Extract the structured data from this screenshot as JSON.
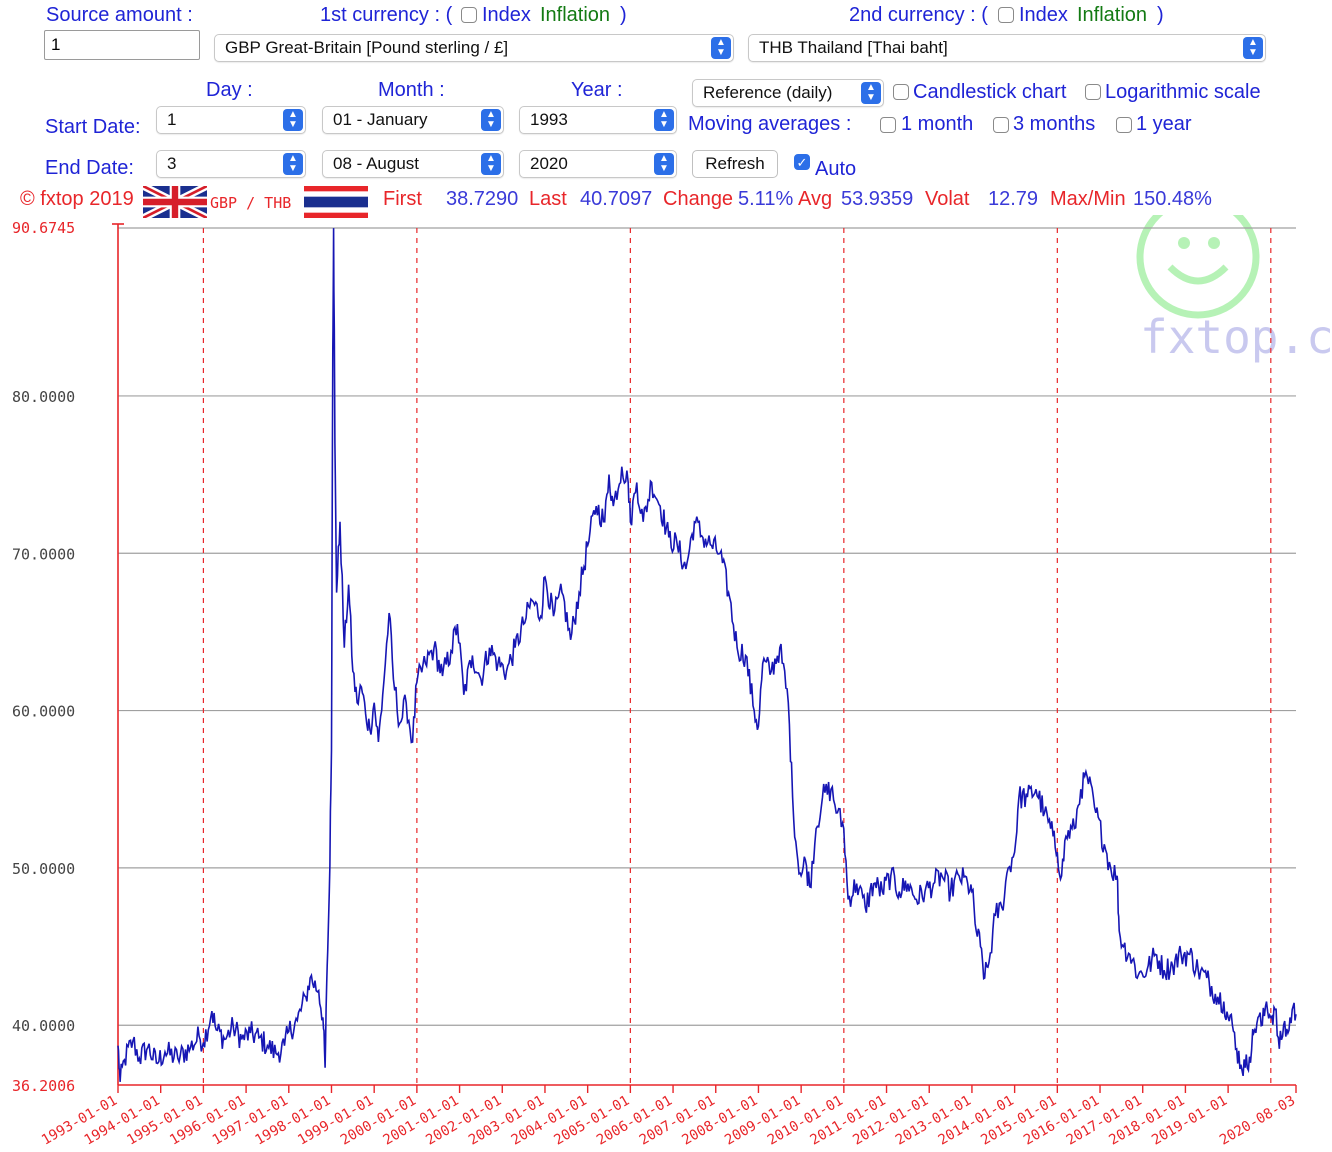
{
  "form": {
    "source_amount_label": "Source amount :",
    "source_amount_value": "1",
    "currency1_label": "1st currency : (",
    "currency2_label": "2nd currency : (",
    "index_label": "Index",
    "inflation_label": "Inflation",
    "close_paren": ")",
    "currency1_value": "GBP Great-Britain [Pound sterling / £]",
    "currency2_value": "THB Thailand [Thai baht]",
    "day_label": "Day :",
    "month_label": "Month :",
    "year_label": "Year :",
    "start_date_label": "Start Date:",
    "end_date_label": "End Date:",
    "start_day": "1",
    "start_month": "01 - January",
    "start_year": "1993",
    "end_day": "3",
    "end_month": "08 - August",
    "end_year": "2020",
    "rate_type": "Reference (daily)",
    "candlestick_label": "Candlestick chart",
    "log_scale_label": "Logarithmic scale",
    "moving_averages_label": "Moving averages :",
    "ma_1_month": "1 month",
    "ma_3_months": "3 months",
    "ma_1_year": "1 year",
    "refresh_label": "Refresh",
    "auto_label": "Auto"
  },
  "info_bar": {
    "copyright": "© fxtop 2019",
    "pair": "GBP / THB",
    "first_label": "First",
    "first_value": "38.7290",
    "last_label": "Last",
    "last_value": "40.7097",
    "change_label": "Change",
    "change_value": "5.11%",
    "avg_label": "Avg",
    "avg_value": "53.9359",
    "volat_label": "Volat",
    "volat_value": "12.79",
    "maxmin_label": "Max/Min",
    "maxmin_value": "150.48%"
  },
  "watermark": "fxtop.com",
  "colors": {
    "line": "#1616b4",
    "axis": "#e8262a",
    "grid": "#a0a0a0",
    "label_blue": "#1f24d6"
  },
  "chart_data": {
    "type": "line",
    "series_name": "GBP / THB",
    "ylim": [
      36.2006,
      90.6745
    ],
    "xlim": [
      1993.0,
      2020.59
    ],
    "y_tick_labels": [
      "90.6745",
      "80.0000",
      "70.0000",
      "60.0000",
      "50.0000",
      "40.0000",
      "36.2006"
    ],
    "y_tick_values": [
      90.6745,
      80,
      70,
      60,
      50,
      40,
      36.2006
    ],
    "x_tick_labels": [
      "1993-01-01",
      "1994-01-01",
      "1995-01-01",
      "1996-01-01",
      "1997-01-01",
      "1998-01-01",
      "1999-01-01",
      "2000-01-01",
      "2001-01-01",
      "2002-01-01",
      "2003-01-01",
      "2004-01-01",
      "2005-01-01",
      "2006-01-01",
      "2007-01-01",
      "2008-01-01",
      "2009-01-01",
      "2010-01-01",
      "2011-01-01",
      "2012-01-01",
      "2013-01-01",
      "2014-01-01",
      "2015-01-01",
      "2016-01-01",
      "2017-01-01",
      "2018-01-01",
      "2019-01-01",
      "2020-08-03"
    ],
    "x_tick_values": [
      1993,
      1994,
      1995,
      1996,
      1997,
      1998,
      1999,
      2000,
      2001,
      2002,
      2003,
      2004,
      2005,
      2006,
      2007,
      2008,
      2009,
      2010,
      2011,
      2012,
      2013,
      2014,
      2015,
      2016,
      2017,
      2018,
      2019,
      2020.59
    ],
    "red_gridlines_x": [
      1995,
      2000,
      2005,
      2010,
      2015,
      2020
    ],
    "grid": true,
    "points": [
      [
        1993.0,
        38.7
      ],
      [
        1993.05,
        36.4
      ],
      [
        1993.15,
        37.8
      ],
      [
        1993.35,
        39.0
      ],
      [
        1993.5,
        37.9
      ],
      [
        1993.7,
        38.6
      ],
      [
        1993.9,
        37.6
      ],
      [
        1994.1,
        38.3
      ],
      [
        1994.4,
        37.9
      ],
      [
        1994.7,
        38.6
      ],
      [
        1994.9,
        39.3
      ],
      [
        1995.0,
        38.9
      ],
      [
        1995.2,
        40.9
      ],
      [
        1995.3,
        39.7
      ],
      [
        1995.5,
        39.1
      ],
      [
        1995.7,
        39.9
      ],
      [
        1995.9,
        39.1
      ],
      [
        1996.1,
        39.5
      ],
      [
        1996.3,
        39.2
      ],
      [
        1996.5,
        38.7
      ],
      [
        1996.7,
        38.2
      ],
      [
        1996.9,
        38.7
      ],
      [
        1997.0,
        39.6
      ],
      [
        1997.2,
        40.3
      ],
      [
        1997.4,
        41.8
      ],
      [
        1997.5,
        43.0
      ],
      [
        1997.7,
        42.2
      ],
      [
        1997.8,
        40.5
      ],
      [
        1997.85,
        37.3
      ],
      [
        1997.9,
        43.8
      ],
      [
        1997.95,
        48.5
      ],
      [
        1998.0,
        57.5
      ],
      [
        1998.03,
        83.0
      ],
      [
        1998.05,
        90.67
      ],
      [
        1998.08,
        77.0
      ],
      [
        1998.12,
        67.5
      ],
      [
        1998.2,
        72.0
      ],
      [
        1998.3,
        64.0
      ],
      [
        1998.4,
        68.0
      ],
      [
        1998.5,
        62.5
      ],
      [
        1998.6,
        60.5
      ],
      [
        1998.7,
        61.5
      ],
      [
        1998.8,
        59.8
      ],
      [
        1998.9,
        58.8
      ],
      [
        1999.0,
        60.5
      ],
      [
        1999.1,
        58.0
      ],
      [
        1999.2,
        61.0
      ],
      [
        1999.35,
        66.2
      ],
      [
        1999.45,
        62.0
      ],
      [
        1999.6,
        59.2
      ],
      [
        1999.75,
        60.5
      ],
      [
        1999.9,
        58.0
      ],
      [
        2000.0,
        61.8
      ],
      [
        2000.2,
        63.0
      ],
      [
        2000.4,
        64.0
      ],
      [
        2000.6,
        62.2
      ],
      [
        2000.8,
        63.8
      ],
      [
        2000.95,
        65.5
      ],
      [
        2001.1,
        61.0
      ],
      [
        2001.3,
        63.5
      ],
      [
        2001.5,
        62.0
      ],
      [
        2001.7,
        64.0
      ],
      [
        2001.9,
        63.0
      ],
      [
        2002.1,
        62.5
      ],
      [
        2002.3,
        64.0
      ],
      [
        2002.5,
        65.5
      ],
      [
        2002.7,
        67.0
      ],
      [
        2002.9,
        66.0
      ],
      [
        2003.0,
        68.5
      ],
      [
        2003.2,
        66.0
      ],
      [
        2003.4,
        67.5
      ],
      [
        2003.6,
        64.5
      ],
      [
        2003.8,
        67.5
      ],
      [
        2004.0,
        70.5
      ],
      [
        2004.2,
        73.0
      ],
      [
        2004.4,
        72.0
      ],
      [
        2004.5,
        75.0
      ],
      [
        2004.6,
        73.0
      ],
      [
        2004.8,
        75.5
      ],
      [
        2004.95,
        74.5
      ],
      [
        2005.0,
        72.0
      ],
      [
        2005.15,
        74.5
      ],
      [
        2005.3,
        72.0
      ],
      [
        2005.5,
        74.5
      ],
      [
        2005.7,
        73.0
      ],
      [
        2005.9,
        71.0
      ],
      [
        2006.1,
        70.5
      ],
      [
        2006.3,
        69.0
      ],
      [
        2006.5,
        72.0
      ],
      [
        2006.7,
        71.0
      ],
      [
        2006.9,
        70.5
      ],
      [
        2007.1,
        70.0
      ],
      [
        2007.3,
        67.5
      ],
      [
        2007.5,
        64.0
      ],
      [
        2007.7,
        63.5
      ],
      [
        2007.9,
        60.0
      ],
      [
        2008.0,
        59.0
      ],
      [
        2008.1,
        63.0
      ],
      [
        2008.3,
        62.5
      ],
      [
        2008.5,
        64.0
      ],
      [
        2008.7,
        60.5
      ],
      [
        2008.8,
        54.5
      ],
      [
        2008.9,
        51.0
      ],
      [
        2009.0,
        49.5
      ],
      [
        2009.1,
        50.5
      ],
      [
        2009.2,
        48.8
      ],
      [
        2009.35,
        52.5
      ],
      [
        2009.5,
        54.5
      ],
      [
        2009.7,
        55.0
      ],
      [
        2009.85,
        53.5
      ],
      [
        2010.0,
        52.5
      ],
      [
        2010.1,
        48.0
      ],
      [
        2010.3,
        49.0
      ],
      [
        2010.5,
        47.5
      ],
      [
        2010.7,
        49.0
      ],
      [
        2010.9,
        48.5
      ],
      [
        2011.1,
        49.5
      ],
      [
        2011.3,
        48.5
      ],
      [
        2011.5,
        49.0
      ],
      [
        2011.7,
        48.0
      ],
      [
        2011.9,
        48.5
      ],
      [
        2012.1,
        49.0
      ],
      [
        2012.3,
        49.5
      ],
      [
        2012.5,
        48.5
      ],
      [
        2012.7,
        49.5
      ],
      [
        2012.9,
        49.0
      ],
      [
        2013.0,
        48.5
      ],
      [
        2013.1,
        46.0
      ],
      [
        2013.2,
        45.0
      ],
      [
        2013.3,
        43.0
      ],
      [
        2013.4,
        44.0
      ],
      [
        2013.55,
        47.0
      ],
      [
        2013.7,
        47.5
      ],
      [
        2013.85,
        50.0
      ],
      [
        2014.0,
        51.0
      ],
      [
        2014.1,
        54.5
      ],
      [
        2014.3,
        54.5
      ],
      [
        2014.5,
        55.0
      ],
      [
        2014.7,
        53.5
      ],
      [
        2014.9,
        52.0
      ],
      [
        2015.0,
        51.0
      ],
      [
        2015.1,
        49.5
      ],
      [
        2015.2,
        52.0
      ],
      [
        2015.4,
        52.5
      ],
      [
        2015.55,
        55.0
      ],
      [
        2015.7,
        55.8
      ],
      [
        2015.9,
        53.5
      ],
      [
        2016.1,
        51.5
      ],
      [
        2016.25,
        50.0
      ],
      [
        2016.4,
        49.5
      ],
      [
        2016.45,
        46.0
      ],
      [
        2016.55,
        45.0
      ],
      [
        2016.7,
        44.5
      ],
      [
        2016.9,
        43.2
      ],
      [
        2017.1,
        43.5
      ],
      [
        2017.3,
        44.5
      ],
      [
        2017.5,
        43.5
      ],
      [
        2017.7,
        43.8
      ],
      [
        2017.9,
        44.5
      ],
      [
        2018.1,
        44.5
      ],
      [
        2018.3,
        43.5
      ],
      [
        2018.5,
        43.0
      ],
      [
        2018.7,
        42.0
      ],
      [
        2018.9,
        41.5
      ],
      [
        2019.0,
        40.5
      ],
      [
        2019.1,
        40.0
      ],
      [
        2019.2,
        38.5
      ],
      [
        2019.3,
        37.5
      ],
      [
        2019.4,
        37.3
      ],
      [
        2019.5,
        38.0
      ],
      [
        2019.6,
        39.5
      ],
      [
        2019.7,
        40.5
      ],
      [
        2019.8,
        40.0
      ],
      [
        2019.9,
        41.5
      ],
      [
        2020.0,
        40.5
      ],
      [
        2020.1,
        41.0
      ],
      [
        2020.2,
        38.5
      ],
      [
        2020.3,
        40.0
      ],
      [
        2020.4,
        39.5
      ],
      [
        2020.5,
        41.0
      ],
      [
        2020.59,
        40.7
      ]
    ]
  }
}
